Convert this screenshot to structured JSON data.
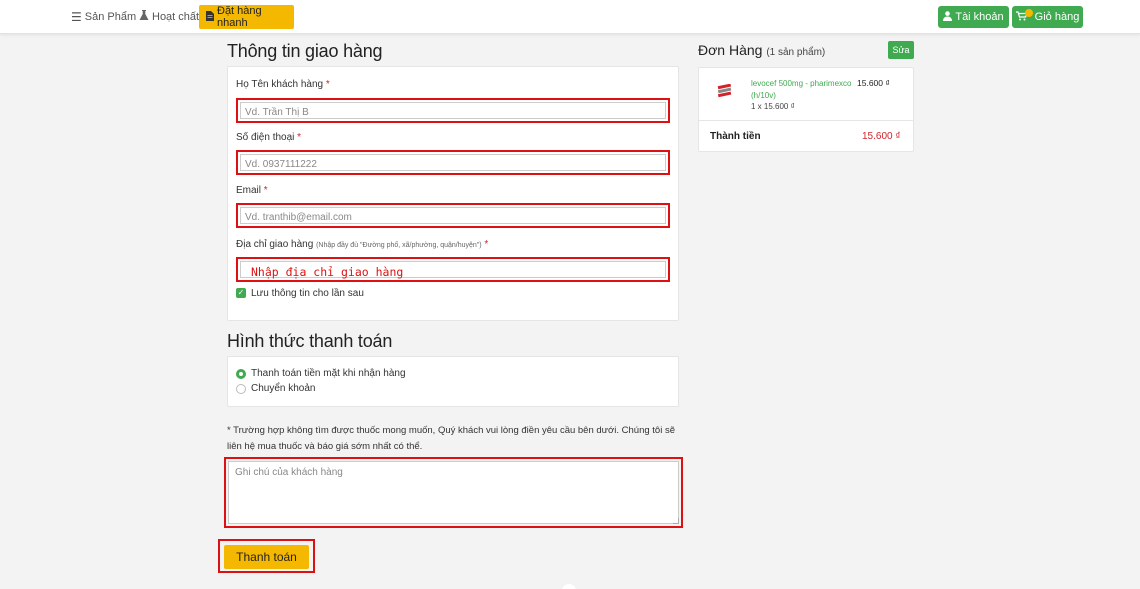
{
  "nav": {
    "products": {
      "icon": "menu-icon",
      "label": "Sản Phẩm"
    },
    "ingredients": {
      "icon": "flask-icon",
      "label": "Hoạt chất"
    },
    "quick_order": {
      "icon": "document-icon",
      "label": "Đặt hàng nhanh"
    },
    "account": {
      "icon": "user-icon",
      "label": "Tài khoản"
    },
    "cart": {
      "icon": "cart-icon",
      "label": "Giỏ hàng"
    }
  },
  "shipping": {
    "heading": "Thông tin giao hàng",
    "name": {
      "label": "Họ Tên khách hàng",
      "required_mark": "*",
      "placeholder": "Vd. Trần Thị B",
      "value": ""
    },
    "phone": {
      "label": "Số điện thoại",
      "required_mark": "*",
      "placeholder": "Vd. 0937111222",
      "value": ""
    },
    "email": {
      "label": "Email",
      "required_mark": "*",
      "placeholder": "Vd. tranthib@email.com",
      "value": ""
    },
    "address": {
      "label": "Địa chỉ giao hàng",
      "hint": "(Nhập đầy đủ \"Đường phố, xã/phường, quận/huyện\")",
      "required_mark": "*",
      "placeholder": "Nhập địa chỉ giao hàng",
      "value": ""
    },
    "save_info": {
      "label": "Lưu thông tin cho lần sau",
      "checked": true
    }
  },
  "payment": {
    "heading": "Hình thức thanh toán",
    "options": [
      {
        "label": "Thanh toán tiền mặt khi nhận hàng",
        "selected": true
      },
      {
        "label": "Chuyển khoản",
        "selected": false
      }
    ]
  },
  "note": {
    "text": "* Trường hợp không tìm được thuốc mong muốn, Quý khách vui lòng điền yêu cầu bên dưới. Chúng tôi sẽ liên hệ mua thuốc và báo giá sớm nhất có thể.",
    "placeholder": "Ghi chú của khách hàng"
  },
  "submit_label": "Thanh toán",
  "order": {
    "title": "Đơn Hàng",
    "count_text": "(1 sản phẩm)",
    "edit_label": "Sửa",
    "items": [
      {
        "name": "levocef 500mg - pharimexco (h/10v)",
        "qty_text": "1 x 15.600 ₫",
        "price": "15.600 ₫"
      }
    ],
    "total_label": "Thành tiền",
    "total_value": "15.600 ₫"
  },
  "colors": {
    "accent_green": "#3faa4f",
    "accent_yellow": "#f5b800",
    "required_red": "#d2232a",
    "highlight_border": "#dd1111"
  }
}
